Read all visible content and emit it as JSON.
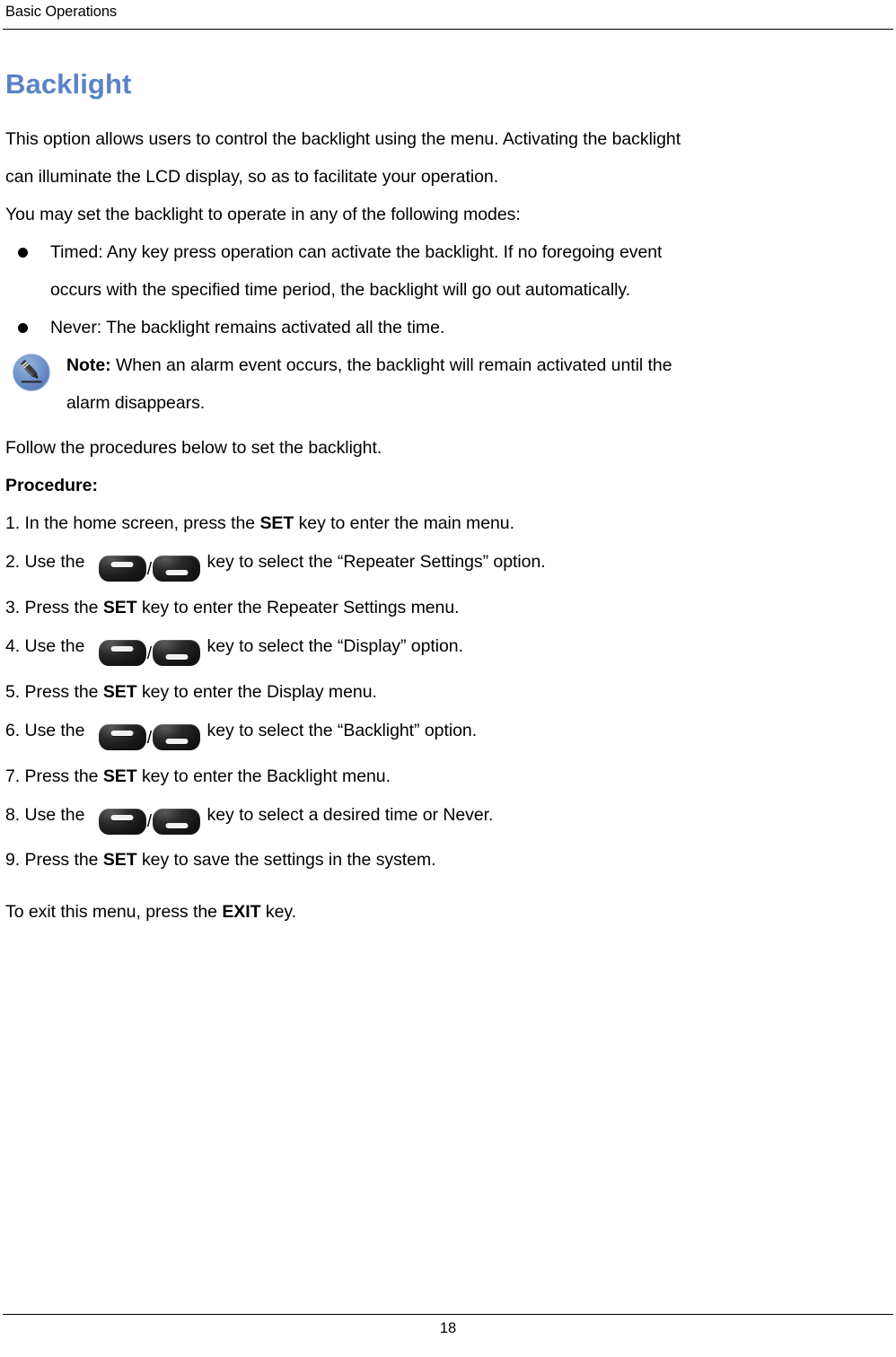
{
  "header": {
    "running_title": "Basic Operations"
  },
  "section": {
    "title": "Backlight",
    "title_color": "#5b82c8",
    "intro_paragraph_1": "This option allows users to control the backlight using the menu. Activating the backlight",
    "intro_paragraph_2": "can illuminate the LCD display, so as to facilitate your operation.",
    "intro_paragraph_3": "You may set the backlight to operate in any of the following modes:"
  },
  "modes": [
    {
      "line1": "Timed: Any key press operation can activate the backlight. If no foregoing event",
      "line2": "occurs with the specified time period, the backlight will go out automatically."
    },
    {
      "line1": "Never: The backlight remains activated all the time.",
      "line2": ""
    }
  ],
  "note": {
    "icon": "pencil-note-icon",
    "icon_circle_color": "#6b8fc9",
    "label": "Note:",
    "line1": " When an alarm event occurs, the backlight will remain activated until the",
    "line2": "alarm disappears."
  },
  "procedure": {
    "lead_in": "Follow the procedures below to set the backlight.",
    "heading": "Procedure:",
    "steps": [
      {
        "number": "1.",
        "pre": " In the home screen, press the ",
        "key": "SET",
        "post": " key to enter the main menu.",
        "has_arrow_keys": false
      },
      {
        "number": "2.",
        "pre": " Use the ",
        "key": "",
        "post": " key to select the “Repeater Settings” option.",
        "has_arrow_keys": true
      },
      {
        "number": "3.",
        "pre": " Press the ",
        "key": "SET",
        "post": " key to enter the Repeater Settings menu.",
        "has_arrow_keys": false
      },
      {
        "number": "4.",
        "pre": " Use the ",
        "key": "",
        "post": " key to select the “Display” option.",
        "has_arrow_keys": true
      },
      {
        "number": "5.",
        "pre": " Press the ",
        "key": "SET",
        "post": " key to enter the Display menu.",
        "has_arrow_keys": false
      },
      {
        "number": "6.",
        "pre": " Use the ",
        "key": "",
        "post": " key to select the “Backlight” option.",
        "has_arrow_keys": true
      },
      {
        "number": "7.",
        "pre": " Press the ",
        "key": "SET",
        "post": " key to enter the Backlight menu.",
        "has_arrow_keys": false
      },
      {
        "number": "8.",
        "pre": " Use the ",
        "key": "",
        "post": " key to select a desired time or Never.",
        "has_arrow_keys": true
      },
      {
        "number": "9.",
        "pre": " Press the ",
        "key": "SET",
        "post": " key to save the settings in the system.",
        "has_arrow_keys": false
      }
    ],
    "exit_pre": "To exit this menu, press the ",
    "exit_key": "EXIT",
    "exit_post": " key."
  },
  "keys": {
    "up_key_icon": "up-arrow-key-icon",
    "down_key_icon": "down-arrow-key-icon",
    "separator": "/"
  },
  "footer": {
    "page_number": "18"
  }
}
